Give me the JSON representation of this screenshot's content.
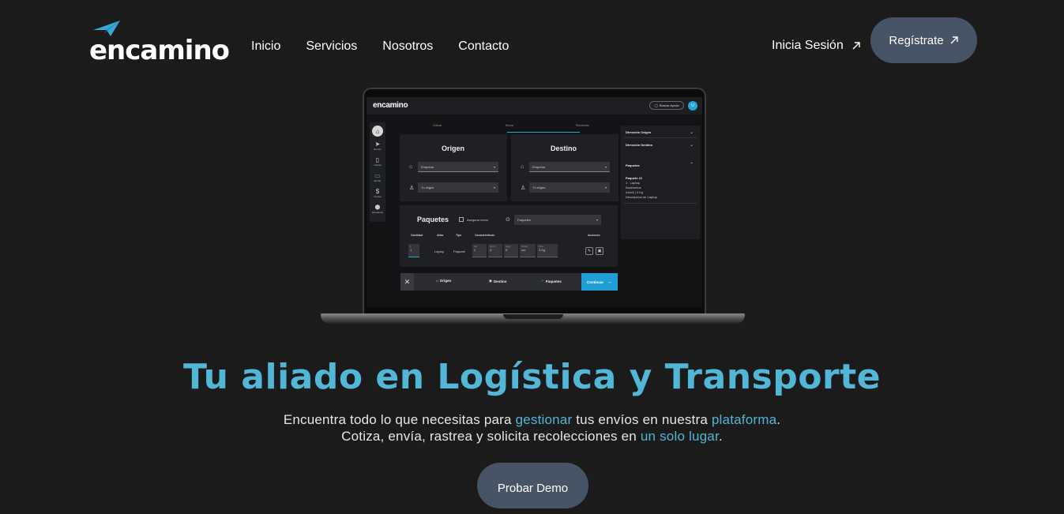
{
  "brand": {
    "name": "encamino",
    "accent_color": "#52b6d6",
    "plane_icon": "paper-plane-icon"
  },
  "nav": {
    "items": [
      "Inicio",
      "Servicios",
      "Nosotros",
      "Contacto"
    ]
  },
  "auth": {
    "login_label": "Inicia Sesión",
    "register_label": "Regístrate",
    "arrow_icon": "arrow-up-right-icon"
  },
  "screen": {
    "app_name": "encamino",
    "help_label": "Buscar Ayuda",
    "avatar_initial": "U",
    "sidebar": [
      "Envíos",
      "Libreta",
      "Envíar",
      "Cotizar",
      "Recolectar"
    ],
    "steps": [
      "Cotizar",
      "Envíar",
      "Recolectar"
    ],
    "origin": {
      "title": "Origen",
      "company": "Empresa",
      "contact": "Tú eliges"
    },
    "destination": {
      "title": "Destino",
      "company": "Empresa",
      "contact": "Tú eliges"
    },
    "packages": {
      "title": "Paquetes",
      "insure_label": "Asegurar envío",
      "select_value": "Paquetes",
      "headers": [
        "Cantidad",
        "Alias",
        "Tipo",
        "Características",
        "Acciones"
      ],
      "row": {
        "quantity_label": "#",
        "quantity": "1",
        "alias": "Laptop",
        "type": "Paquete",
        "alto_label": "Alto",
        "alto": "2",
        "ancho_label": "Ancho",
        "ancho": "4",
        "largo_label": "Largo",
        "largo": "5",
        "unidad_label": "Unidad",
        "unidad": "cm",
        "peso_label": "Peso",
        "peso": "3",
        "peso_unit": "Kg"
      }
    },
    "right_panel": {
      "origin_label": "Dirección Origen",
      "destination_label": "Dirección Destino",
      "packages_label": "Paquetes",
      "package_title": "Paquete #1",
      "package_lines": [
        "1 · Laptop",
        "Accesorios",
        "2x4x5 | 3 Kg",
        "Descripcion de Laptop"
      ]
    },
    "bottom_bar": {
      "origin": "Origen",
      "destination": "Destino",
      "packages": "Paquetes",
      "continue": "Continuar"
    }
  },
  "hero": {
    "title": "Tu aliado en Logística y Transporte",
    "line1_a": "Encuentra todo lo que necesitas para ",
    "line1_hl1": "gestionar",
    "line1_b": " tus envíos en nuestra ",
    "line1_hl2": "plataforma",
    "line1_c": ".",
    "line2_a": "Cotiza, envía, rastrea y solicita recolecciones en ",
    "line2_hl": "un solo lugar",
    "line2_c": ".",
    "cta": "Probar Demo"
  }
}
